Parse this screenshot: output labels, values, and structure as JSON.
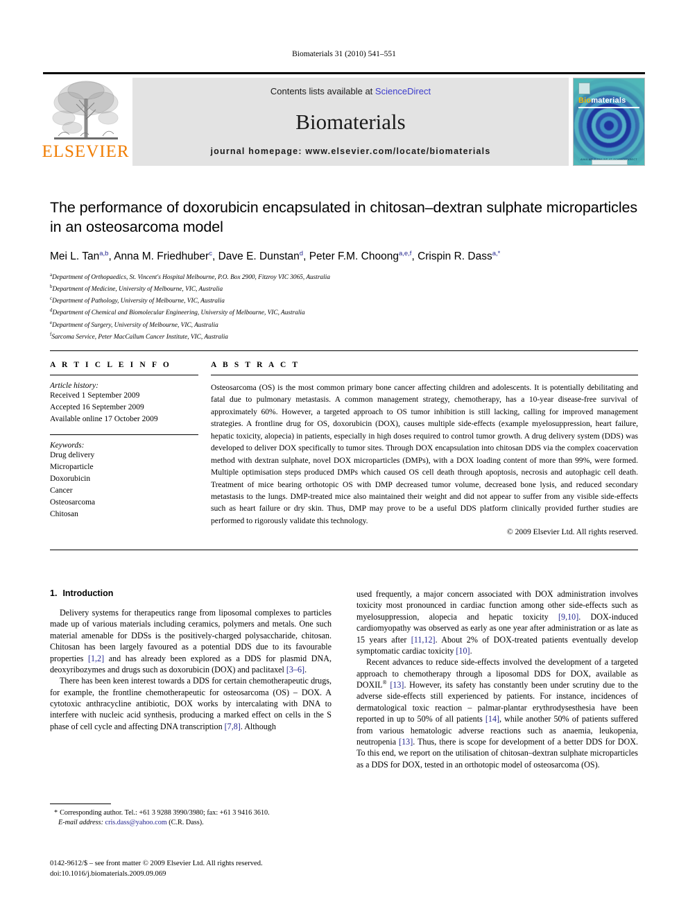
{
  "running_head": "Biomaterials 31 (2010) 541–551",
  "masthead": {
    "publisher_name": "ELSEVIER",
    "contents_prefix": "Contents lists available at ",
    "contents_link": "ScienceDirect",
    "journal_name": "Biomaterials",
    "homepage": "journal homepage: www.elsevier.com/locate/biomaterials",
    "cover": {
      "title_part1": "Bio",
      "title_part2": "materials",
      "footer_text": "AVAILABLE ONLINE AT SCIENCEDIRECT"
    },
    "colors": {
      "elsevier_orange": "#F07C00",
      "link_blue": "#3b3bcc",
      "panel_grey": "#e3e3e3",
      "cover_teal": "#4fb8b8",
      "cover_blue": "#1c2f9c"
    }
  },
  "article": {
    "title": "The performance of doxorubicin encapsulated in chitosan–dextran sulphate microparticles in an osteosarcoma model",
    "authors": [
      {
        "name": "Mei L. Tan",
        "marks": "a,b",
        "sep": ", "
      },
      {
        "name": "Anna M. Friedhuber",
        "marks": "c",
        "sep": ", "
      },
      {
        "name": "Dave E. Dunstan",
        "marks": "d",
        "sep": ", "
      },
      {
        "name": "Peter F.M. Choong",
        "marks": "a,e,f",
        "sep": ", "
      },
      {
        "name": "Crispin R. Dass",
        "marks": "a,*",
        "sep": ""
      }
    ],
    "affiliations": [
      {
        "mark": "a",
        "text": "Department of Orthopaedics, St. Vincent's Hospital Melbourne, P.O. Box 2900, Fitzroy VIC 3065, Australia"
      },
      {
        "mark": "b",
        "text": "Department of Medicine, University of Melbourne, VIC, Australia"
      },
      {
        "mark": "c",
        "text": "Department of Pathology, University of Melbourne, VIC, Australia"
      },
      {
        "mark": "d",
        "text": "Department of Chemical and Biomolecular Engineering, University of Melbourne, VIC, Australia"
      },
      {
        "mark": "e",
        "text": "Department of Surgery, University of Melbourne, VIC, Australia"
      },
      {
        "mark": "f",
        "text": "Sarcoma Service, Peter MacCallum Cancer Institute, VIC, Australia"
      }
    ]
  },
  "article_info": {
    "heading": "A R T I C L E  I N F O",
    "history_label": "Article history:",
    "history": [
      "Received 1 September 2009",
      "Accepted 16 September 2009",
      "Available online 17 October 2009"
    ],
    "keywords_label": "Keywords:",
    "keywords": [
      "Drug delivery",
      "Microparticle",
      "Doxorubicin",
      "Cancer",
      "Osteosarcoma",
      "Chitosan"
    ]
  },
  "abstract": {
    "heading": "A B S T R A C T",
    "text": "Osteosarcoma (OS) is the most common primary bone cancer affecting children and adolescents. It is potentially debilitating and fatal due to pulmonary metastasis. A common management strategy, chemotherapy, has a 10-year disease-free survival of approximately 60%. However, a targeted approach to OS tumor inhibition is still lacking, calling for improved management strategies. A frontline drug for OS, doxorubicin (DOX), causes multiple side-effects (example myelosuppression, heart failure, hepatic toxicity, alopecia) in patients, especially in high doses required to control tumor growth. A drug delivery system (DDS) was developed to deliver DOX specifically to tumor sites. Through DOX encapsulation into chitosan DDS via the complex coacervation method with dextran sulphate, novel DOX microparticles (DMPs), with a DOX loading content of more than 99%, were formed. Multiple optimisation steps produced DMPs which caused OS cell death through apoptosis, necrosis and autophagic cell death. Treatment of mice bearing orthotopic OS with DMP decreased tumor volume, decreased bone lysis, and reduced secondary metastasis to the lungs. DMP-treated mice also maintained their weight and did not appear to suffer from any visible side-effects such as heart failure or dry skin. Thus, DMP may prove to be a useful DDS platform clinically provided further studies are performed to rigorously validate this technology.",
    "copyright": "© 2009 Elsevier Ltd. All rights reserved."
  },
  "introduction": {
    "number": "1.",
    "heading": "Introduction",
    "left_paragraphs": [
      "Delivery systems for therapeutics range from liposomal complexes to particles made up of various materials including ceramics, polymers and metals. One such material amenable for DDSs is the positively-charged polysaccharide, chitosan. Chitosan has been largely favoured as a potential DDS due to its favourable properties [1,2] and has already been explored as a DDS for plasmid DNA, deoxyribozymes and drugs such as doxorubicin (DOX) and paclitaxel [3–6].",
      "There has been keen interest towards a DDS for certain chemotherapeutic drugs, for example, the frontline chemotherapeutic for osteosarcoma (OS) – DOX. A cytotoxic anthracycline antibiotic, DOX works by intercalating with DNA to interfere with nucleic acid synthesis, producing a marked effect on cells in the S phase of cell cycle and affecting DNA transcription [7,8]. Although"
    ],
    "right_paragraphs": [
      "used frequently, a major concern associated with DOX administration involves toxicity most pronounced in cardiac function among other side-effects such as myelosuppression, alopecia and hepatic toxicity [9,10]. DOX-induced cardiomyopathy was observed as early as one year after administration or as late as 15 years after [11,12]. About 2% of DOX-treated patients eventually develop symptomatic cardiac toxicity [10].",
      "Recent advances to reduce side-effects involved the development of a targeted approach to chemotherapy through a liposomal DDS for DOX, available as DOXIL® [13]. However, its safety has constantly been under scrutiny due to the adverse side-effects still experienced by patients. For instance, incidences of dermatological toxic reaction – palmar-plantar erythrodysesthesia have been reported in up to 50% of all patients [14], while another 50% of patients suffered from various hematologic adverse reactions such as anaemia, leukopenia, neutropenia [13]. Thus, there is scope for development of a better DDS for DOX. To this end, we report on the utilisation of chitosan–dextran sulphate microparticles as a DDS for DOX, tested in an orthotopic model of osteosarcoma (OS)."
    ]
  },
  "footnote": {
    "star": "*",
    "corresponding": "Corresponding author. Tel.: +61 3 9288 3990/3980; fax: +61 3 9416 3610.",
    "email_label": "E-mail address:",
    "email": "cris.dass@yahoo.com",
    "email_owner": "(C.R. Dass)."
  },
  "imprint": {
    "line1": "0142-9612/$ – see front matter © 2009 Elsevier Ltd. All rights reserved.",
    "line2": "doi:10.1016/j.biomaterials.2009.09.069"
  }
}
